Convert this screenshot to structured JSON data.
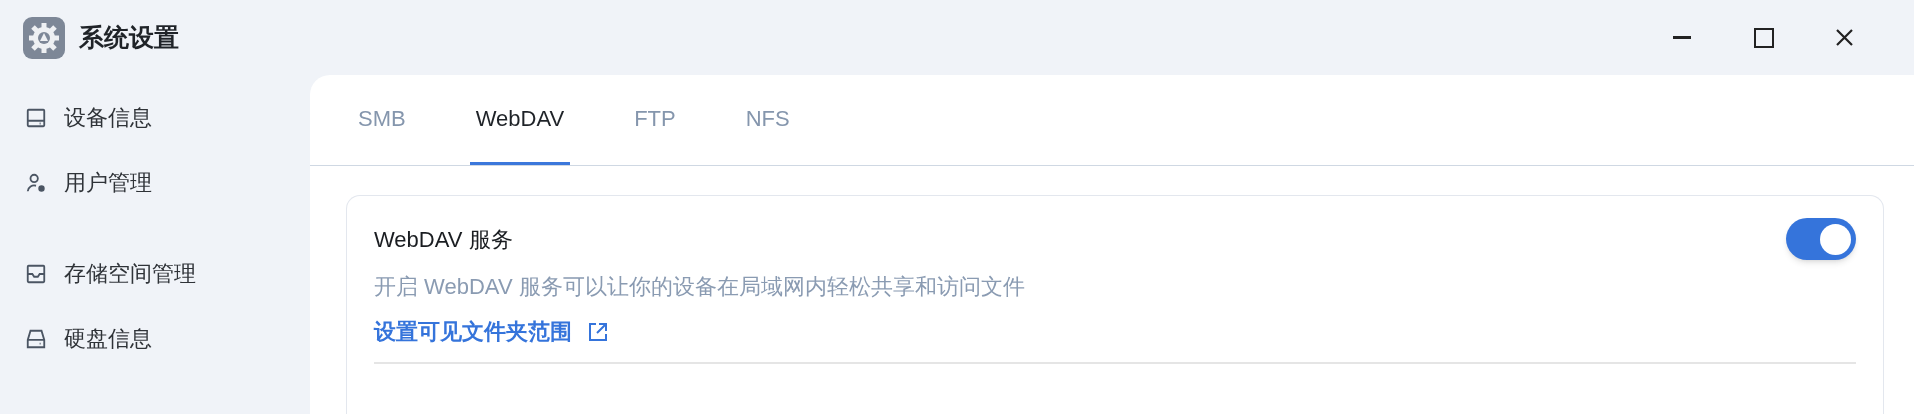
{
  "window": {
    "title": "系统设置"
  },
  "sidebar": {
    "groups": [
      {
        "items": [
          {
            "label": "设备信息"
          },
          {
            "label": "用户管理"
          }
        ]
      },
      {
        "items": [
          {
            "label": "存储空间管理"
          },
          {
            "label": "硬盘信息"
          }
        ]
      }
    ]
  },
  "tabs": [
    {
      "label": "SMB",
      "selected": false
    },
    {
      "label": "WebDAV",
      "selected": true
    },
    {
      "label": "FTP",
      "selected": false
    },
    {
      "label": "NFS",
      "selected": false
    }
  ],
  "service": {
    "title": "WebDAV 服务",
    "on": true,
    "description": "开启 WebDAV 服务可以让你的设备在局域网内轻松共享和访问文件",
    "link": "设置可见文件夹范围"
  }
}
